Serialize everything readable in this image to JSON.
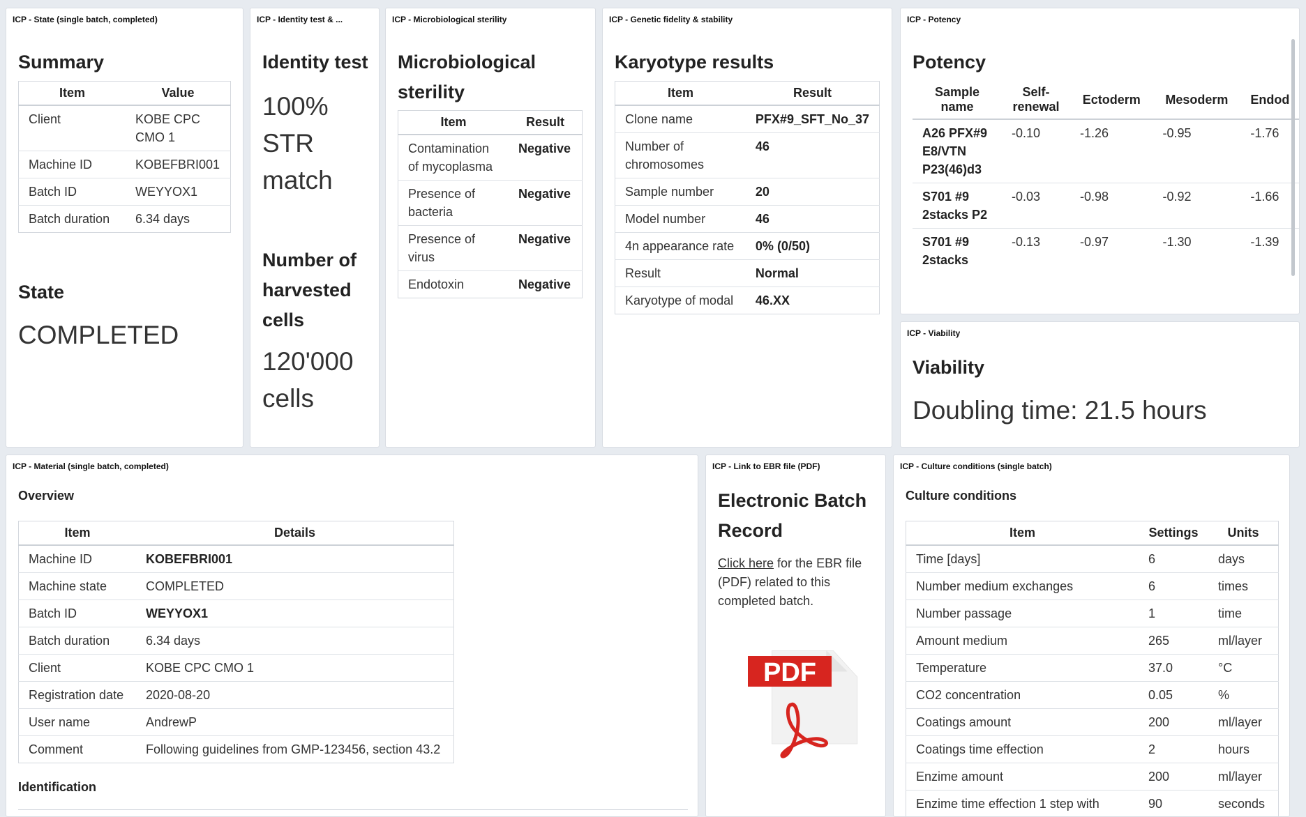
{
  "state_panel": {
    "title": "ICP - State (single batch, completed)",
    "summary_heading": "Summary",
    "col_item": "Item",
    "col_value": "Value",
    "rows": [
      {
        "item": "Client",
        "value": "KOBE CPC CMO 1"
      },
      {
        "item": "Machine ID",
        "value": "KOBEFBRI001"
      },
      {
        "item": "Batch ID",
        "value": "WEYYOX1"
      },
      {
        "item": "Batch duration",
        "value": "6.34 days"
      }
    ],
    "state_heading": "State",
    "state_value": "COMPLETED"
  },
  "identity_panel": {
    "title": "ICP - Identity test & ...",
    "heading": "Identity test",
    "result": "100% STR match",
    "cells_heading": "Number of harvested cells",
    "cells_value": "120'000 cells"
  },
  "sterility_panel": {
    "title": "ICP - Microbiological sterility",
    "heading": "Microbiological sterility",
    "col_item": "Item",
    "col_result": "Result",
    "rows": [
      {
        "item": "Contamination of mycoplasma",
        "result": "Negative"
      },
      {
        "item": "Presence of bacteria",
        "result": "Negative"
      },
      {
        "item": "Presence of virus",
        "result": "Negative"
      },
      {
        "item": "Endotoxin",
        "result": "Negative"
      }
    ]
  },
  "karyotype_panel": {
    "title": "ICP - Genetic fidelity & stability",
    "heading": "Karyotype results",
    "col_item": "Item",
    "col_result": "Result",
    "rows": [
      {
        "item": "Clone name",
        "result": "PFX#9_SFT_No_37"
      },
      {
        "item": "Number of chromosomes",
        "result": "46"
      },
      {
        "item": "Sample number",
        "result": "20"
      },
      {
        "item": "Model number",
        "result": "46"
      },
      {
        "item": "4n appearance rate",
        "result": "0% (0/50)"
      },
      {
        "item": "Result",
        "result": "Normal"
      },
      {
        "item": "Karyotype of modal",
        "result": "46.XX"
      }
    ]
  },
  "potency_panel": {
    "title": "ICP - Potency",
    "heading": "Potency",
    "columns": [
      "Sample name",
      "Self-renewal",
      "Ectoderm",
      "Mesoderm",
      "Endod"
    ],
    "rows": [
      {
        "sample": "A26 PFX#9 E8/VTN P23(46)d3",
        "self": "-0.10",
        "ecto": "-1.26",
        "meso": "-0.95",
        "endo": "-1.76"
      },
      {
        "sample": "S701 #9 2stacks P2",
        "self": "-0.03",
        "ecto": "-0.98",
        "meso": "-0.92",
        "endo": "-1.66"
      },
      {
        "sample": "S701 #9 2stacks",
        "self": "-0.13",
        "ecto": "-0.97",
        "meso": "-1.30",
        "endo": "-1.39"
      }
    ]
  },
  "viability_panel": {
    "title": "ICP - Viability",
    "heading": "Viability",
    "value": "Doubling time: 21.5 hours"
  },
  "material_panel": {
    "title": "ICP - Material (single batch, completed)",
    "overview_heading": "Overview",
    "col_item": "Item",
    "col_details": "Details",
    "rows": [
      {
        "item": "Machine ID",
        "details": "KOBEFBRI001"
      },
      {
        "item": "Machine state",
        "details": "COMPLETED"
      },
      {
        "item": "Batch ID",
        "details": "WEYYOX1"
      },
      {
        "item": "Batch duration",
        "details": "6.34 days"
      },
      {
        "item": "Client",
        "details": "KOBE CPC CMO 1"
      },
      {
        "item": "Registration date",
        "details": "2020-08-20"
      },
      {
        "item": "User name",
        "details": "AndrewP"
      },
      {
        "item": "Comment",
        "details": "Following guidelines from GMP-123456, section 43.2"
      }
    ],
    "identification_heading": "Identification"
  },
  "ebr_panel": {
    "title": "ICP - Link to EBR file (PDF)",
    "heading": "Electronic Batch Record",
    "link_text": "Click here",
    "rest_text": " for the EBR file (PDF) related to this completed batch.",
    "pdf_label": "PDF"
  },
  "culture_panel": {
    "title": "ICP - Culture conditions (single batch)",
    "heading": "Culture conditions",
    "col_item": "Item",
    "col_settings": "Settings",
    "col_units": "Units",
    "rows": [
      {
        "item": "Time [days]",
        "settings": "6",
        "units": "days"
      },
      {
        "item": "Number medium exchanges",
        "settings": "6",
        "units": "times"
      },
      {
        "item": "Number passage",
        "settings": "1",
        "units": "time"
      },
      {
        "item": "Amount medium",
        "settings": "265",
        "units": "ml/layer"
      },
      {
        "item": "Temperature",
        "settings": "37.0",
        "units": "°C"
      },
      {
        "item": "CO2 concentration",
        "settings": "0.05",
        "units": "%"
      },
      {
        "item": "Coatings amount",
        "settings": "200",
        "units": "ml/layer"
      },
      {
        "item": "Coatings time effection",
        "settings": "2",
        "units": "hours"
      },
      {
        "item": "Enzime amount",
        "settings": "200",
        "units": "ml/layer"
      },
      {
        "item": "Enzime time effection 1 step with",
        "settings": "90",
        "units": "seconds"
      }
    ]
  },
  "colors": {
    "background": "#e7ebf0",
    "panel": "#ffffff",
    "pdf_red": "#d7251f"
  }
}
